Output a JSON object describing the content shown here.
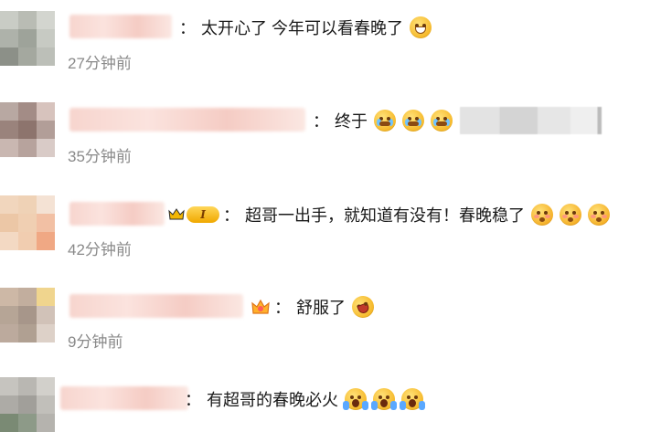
{
  "comments": [
    {
      "text": "太开心了 今年可以看春晚了",
      "time": "27分钟前",
      "emojis": [
        "grin-emoji"
      ]
    },
    {
      "text": "终于",
      "time": "35分钟前",
      "emojis": [
        "cry-emoji",
        "cry-emoji",
        "cry-emoji"
      ]
    },
    {
      "text": "超哥一出手，就知道有没有！春晚稳了",
      "time": "42分钟前",
      "level": "I",
      "emojis": [
        "shy-emoji",
        "shy-emoji",
        "shy-emoji"
      ]
    },
    {
      "text": "舒服了",
      "time": "9分钟前",
      "emojis": [
        "laugh-emoji"
      ]
    },
    {
      "text": "有超哥的春晚必火",
      "time": "",
      "emojis": [
        "scream-emoji",
        "scream-emoji",
        "scream-emoji"
      ]
    }
  ],
  "separator": "："
}
